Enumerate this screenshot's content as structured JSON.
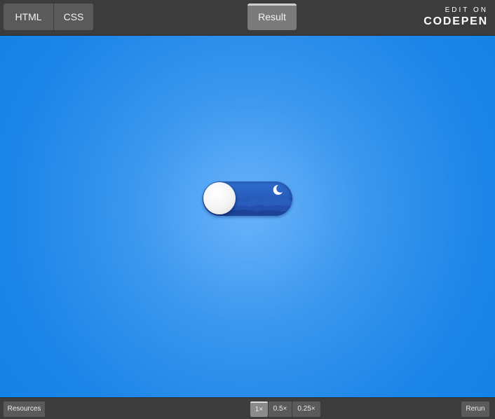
{
  "header": {
    "tabs": [
      {
        "label": "HTML"
      },
      {
        "label": "CSS"
      }
    ],
    "result_tab": {
      "label": "Result",
      "active": true
    },
    "codepen": {
      "edit_label": "EDIT ON",
      "brand_label": "CODEPEN"
    }
  },
  "toggle": {
    "state": "off",
    "theme": "night",
    "knob_icon": "sun-knob",
    "decor_icon": "crescent-moon-icon"
  },
  "footer": {
    "resources_label": "Resources",
    "zoom_options": [
      {
        "label": "1×",
        "selected": true
      },
      {
        "label": "0.5×",
        "selected": false
      },
      {
        "label": "0.25×",
        "selected": false
      }
    ],
    "rerun_label": "Rerun"
  },
  "colors": {
    "stage_center": "#6ab3fb",
    "stage_edge": "#1482e6",
    "toggle_track": "#2759b8",
    "bar": "#3c3c3c"
  }
}
